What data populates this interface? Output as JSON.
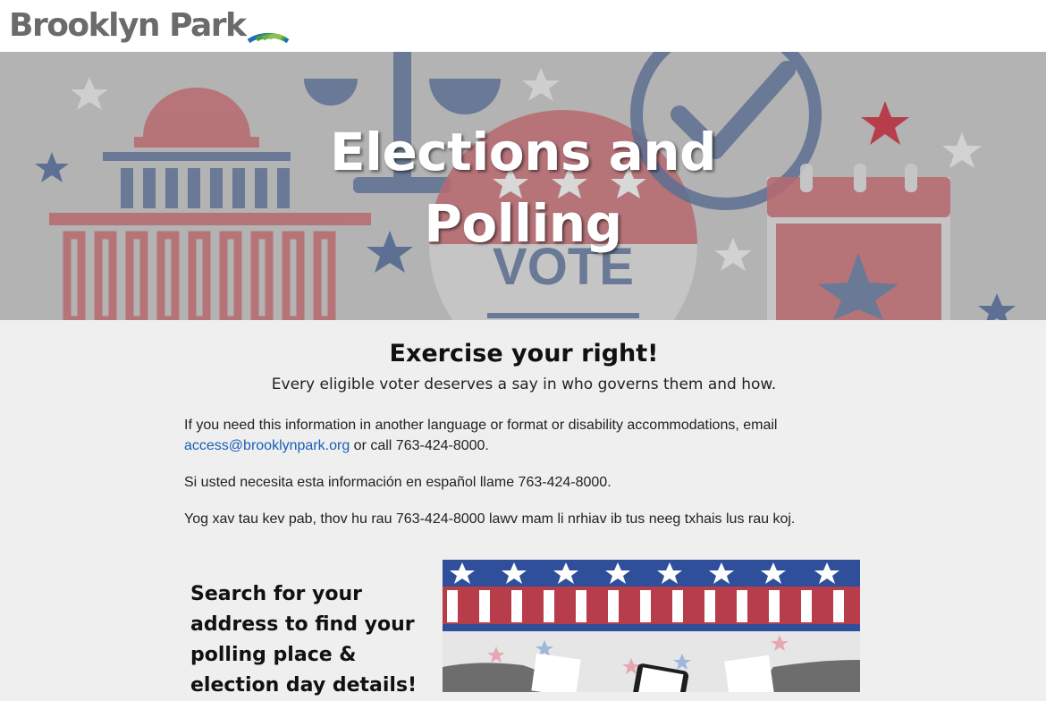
{
  "site": {
    "logo_text": "Brooklyn Park"
  },
  "hero": {
    "title_line1": "Elections and",
    "title_line2": "Polling",
    "vote_label": "VOTE"
  },
  "intro": {
    "heading": "Exercise your right!",
    "subheading": "Every eligible voter deserves a say in who governs them and how.",
    "accessibility_text": "If you need this information in another language or format or disability accommodations, email",
    "email_link": "access@brooklynpark.org",
    "accessibility_suffix": " or call 763-424-8000.",
    "spanish_text": "Si usted necesita esta información en español llame 763-424-8000.",
    "hmong_text": "Yog xav tau kev pab, thov hu rau 763-424-8000 lawv mam li nrhiav ib tus neeg txhais lus rau koj."
  },
  "search": {
    "prompt": "Search for your address to find your polling place & election day details!"
  },
  "colors": {
    "red": "#b73d4a",
    "blue": "#3d5f94",
    "logo_green": "#6ab04c",
    "logo_blue": "#1f6fb8",
    "link": "#1a5fb4"
  }
}
